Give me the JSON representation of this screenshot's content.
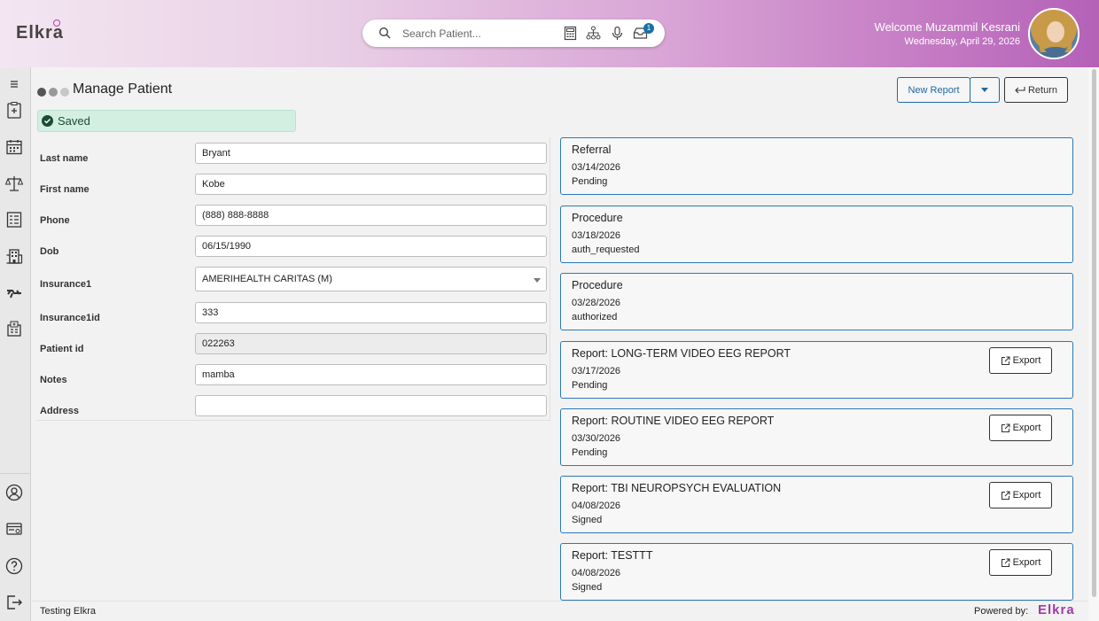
{
  "header": {
    "logo_text": "Elkra",
    "search_placeholder": "Search Patient...",
    "notification_count": "1",
    "welcome_text": "Welcome Muzammil Kesrani",
    "date_text": "Wednesday, April 29, 2026",
    "icons": [
      "search-icon",
      "calculator-icon",
      "org-chart-icon",
      "microphone-icon",
      "inbox-icon"
    ]
  },
  "sidebar": {
    "top_icons": [
      "menu-icon",
      "clipboard-icon",
      "calendar-icon",
      "scale-icon",
      "checklist-icon",
      "building-icon",
      "pills-icon",
      "hospital-icon"
    ],
    "bottom_icons": [
      "user-icon",
      "billing-icon",
      "help-icon",
      "logout-icon"
    ]
  },
  "page": {
    "title": "Manage Patient",
    "new_report_label": "New Report",
    "return_label": "Return",
    "saved_message": "Saved"
  },
  "form": {
    "fields": [
      {
        "label": "Last name",
        "value": "Bryant"
      },
      {
        "label": "First name",
        "value": "Kobe"
      },
      {
        "label": "Phone",
        "value": "(888) 888-8888"
      },
      {
        "label": "Dob",
        "value": "06/15/1990"
      },
      {
        "label": "Insurance1",
        "value": "AMERIHEALTH CARITAS (M)"
      },
      {
        "label": "Insurance1id",
        "value": "333"
      },
      {
        "label": "Patient id",
        "value": "022263"
      },
      {
        "label": "Notes",
        "value": "mamba"
      },
      {
        "label": "Address",
        "value": ""
      }
    ]
  },
  "records": [
    {
      "title": "Referral",
      "date": "03/14/2026",
      "status": "Pending",
      "export": ""
    },
    {
      "title": "Procedure",
      "date": "03/18/2026",
      "status": "auth_requested",
      "export": ""
    },
    {
      "title": "Procedure",
      "date": "03/28/2026",
      "status": "authorized",
      "export": ""
    },
    {
      "title": "Report: LONG-TERM VIDEO EEG REPORT",
      "date": "03/17/2026",
      "status": "Pending",
      "export": "Export"
    },
    {
      "title": "Report: ROUTINE VIDEO EEG REPORT",
      "date": "03/30/2026",
      "status": "Pending",
      "export": "Export"
    },
    {
      "title": "Report: TBI NEUROPSYCH EVALUATION",
      "date": "04/08/2026",
      "status": "Signed",
      "export": "Export"
    },
    {
      "title": "Report: TESTTT",
      "date": "04/08/2026",
      "status": "Signed",
      "export": "Export"
    }
  ],
  "footer": {
    "left_text": "Testing Elkra",
    "powered_by": "Powered by:",
    "brand": "Elkra"
  },
  "colors": {
    "accent_blue": "#1d6aa0",
    "saved_green": "#d3efe2",
    "brand_purple": "#a43aa8"
  }
}
